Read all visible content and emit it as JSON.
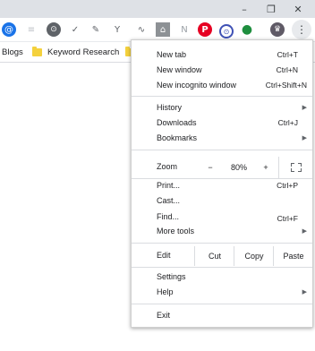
{
  "window": {
    "minimize_icon": "–",
    "restore_icon": "❐",
    "close_icon": "✕"
  },
  "toolbar": {
    "extensions": [
      "@",
      "≡",
      "⊙",
      "✓",
      "✎",
      "Y",
      "∿",
      "⌂",
      "N",
      "P",
      "⊙",
      "●",
      "♛"
    ],
    "menu_glyph": "⋮"
  },
  "bookmarks": {
    "items": [
      {
        "label": "Blogs"
      },
      {
        "label": "Keyword Research"
      }
    ]
  },
  "menu": {
    "new_tab": {
      "label": "New tab",
      "shortcut": "Ctrl+T"
    },
    "new_window": {
      "label": "New window",
      "shortcut": "Ctrl+N"
    },
    "new_incognito": {
      "label": "New incognito window",
      "shortcut": "Ctrl+Shift+N"
    },
    "history": {
      "label": "History"
    },
    "downloads": {
      "label": "Downloads",
      "shortcut": "Ctrl+J"
    },
    "bookmarks": {
      "label": "Bookmarks"
    },
    "zoom": {
      "label": "Zoom",
      "minus": "−",
      "value": "80%",
      "plus": "+"
    },
    "print": {
      "label": "Print...",
      "shortcut": "Ctrl+P"
    },
    "cast": {
      "label": "Cast..."
    },
    "find": {
      "label": "Find...",
      "shortcut": "Ctrl+F"
    },
    "more_tools": {
      "label": "More tools"
    },
    "edit": {
      "label": "Edit",
      "cut": "Cut",
      "copy": "Copy",
      "paste": "Paste"
    },
    "settings": {
      "label": "Settings"
    },
    "help": {
      "label": "Help"
    },
    "exit": {
      "label": "Exit"
    },
    "submenu_arrow": "▶"
  }
}
